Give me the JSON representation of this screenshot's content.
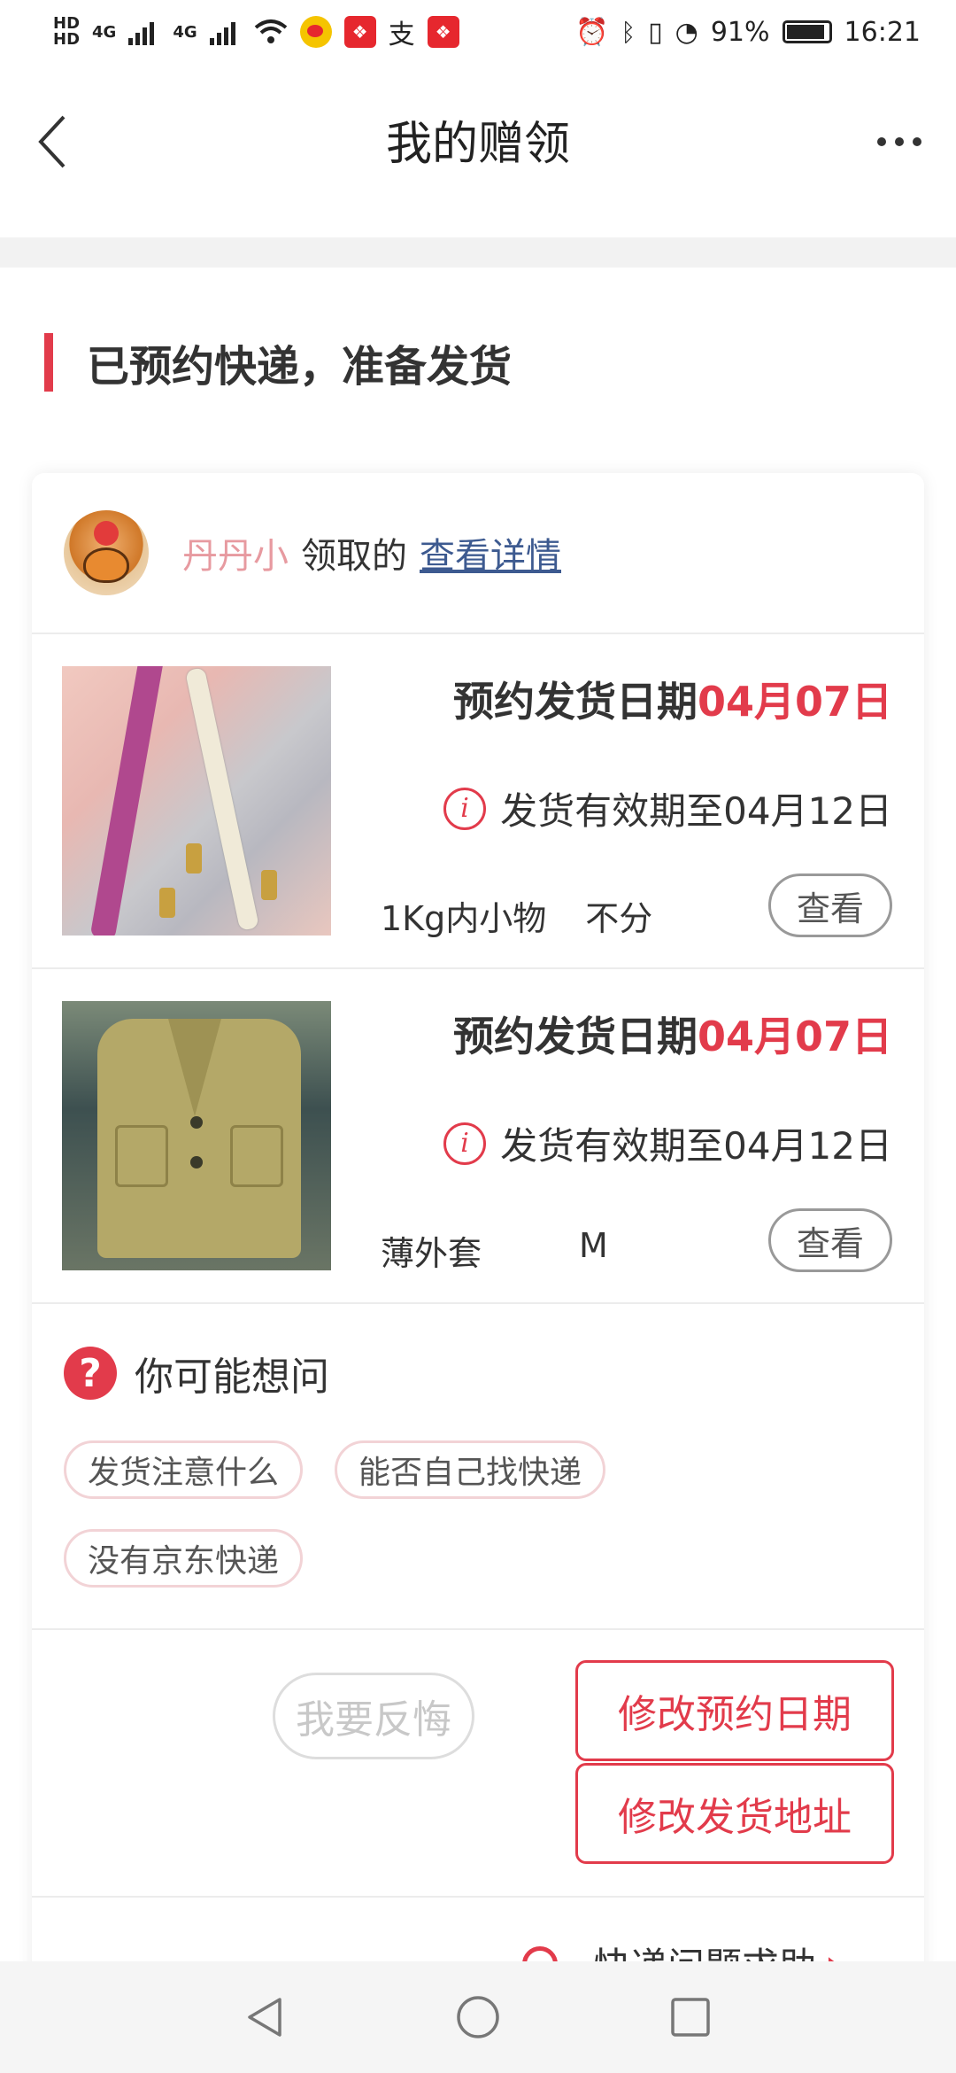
{
  "status_bar": {
    "network_label_1": "HD",
    "network_label_2": "HD",
    "signal_1": "4G",
    "signal_2": "4G",
    "app_icon_alipay": "支",
    "battery_percent": "91%",
    "time": "16:21"
  },
  "header": {
    "title": "我的赠领",
    "back_icon": "chevron-left-icon",
    "more_icon": "more-horizontal-icon"
  },
  "section": {
    "title": "已预约快递，准备发货",
    "accent_color": "#e23b4b"
  },
  "receiver": {
    "name": "丹丹小",
    "action": "领取的",
    "link": "查看详情"
  },
  "items": [
    {
      "date_prefix": "预约发货日期",
      "date_value": "04月07日",
      "valid_text": "发货有效期至04月12日",
      "spec_1": "1Kg内小物",
      "spec_2": "不分",
      "view_label": "查看"
    },
    {
      "date_prefix": "预约发货日期",
      "date_value": "04月07日",
      "valid_text": "发货有效期至04月12日",
      "spec_1": "薄外套",
      "spec_2": "M",
      "view_label": "查看"
    }
  ],
  "faq": {
    "icon_text": "?",
    "title": "你可能想问",
    "tags": [
      "发货注意什么",
      "能否自己找快递",
      "没有京东快递"
    ]
  },
  "actions": {
    "regret": "我要反悔",
    "change_date": "修改预约日期",
    "change_address": "修改发货地址"
  },
  "help": {
    "text": "快递问题求助",
    "chevron": "›"
  },
  "info_glyph": "i"
}
